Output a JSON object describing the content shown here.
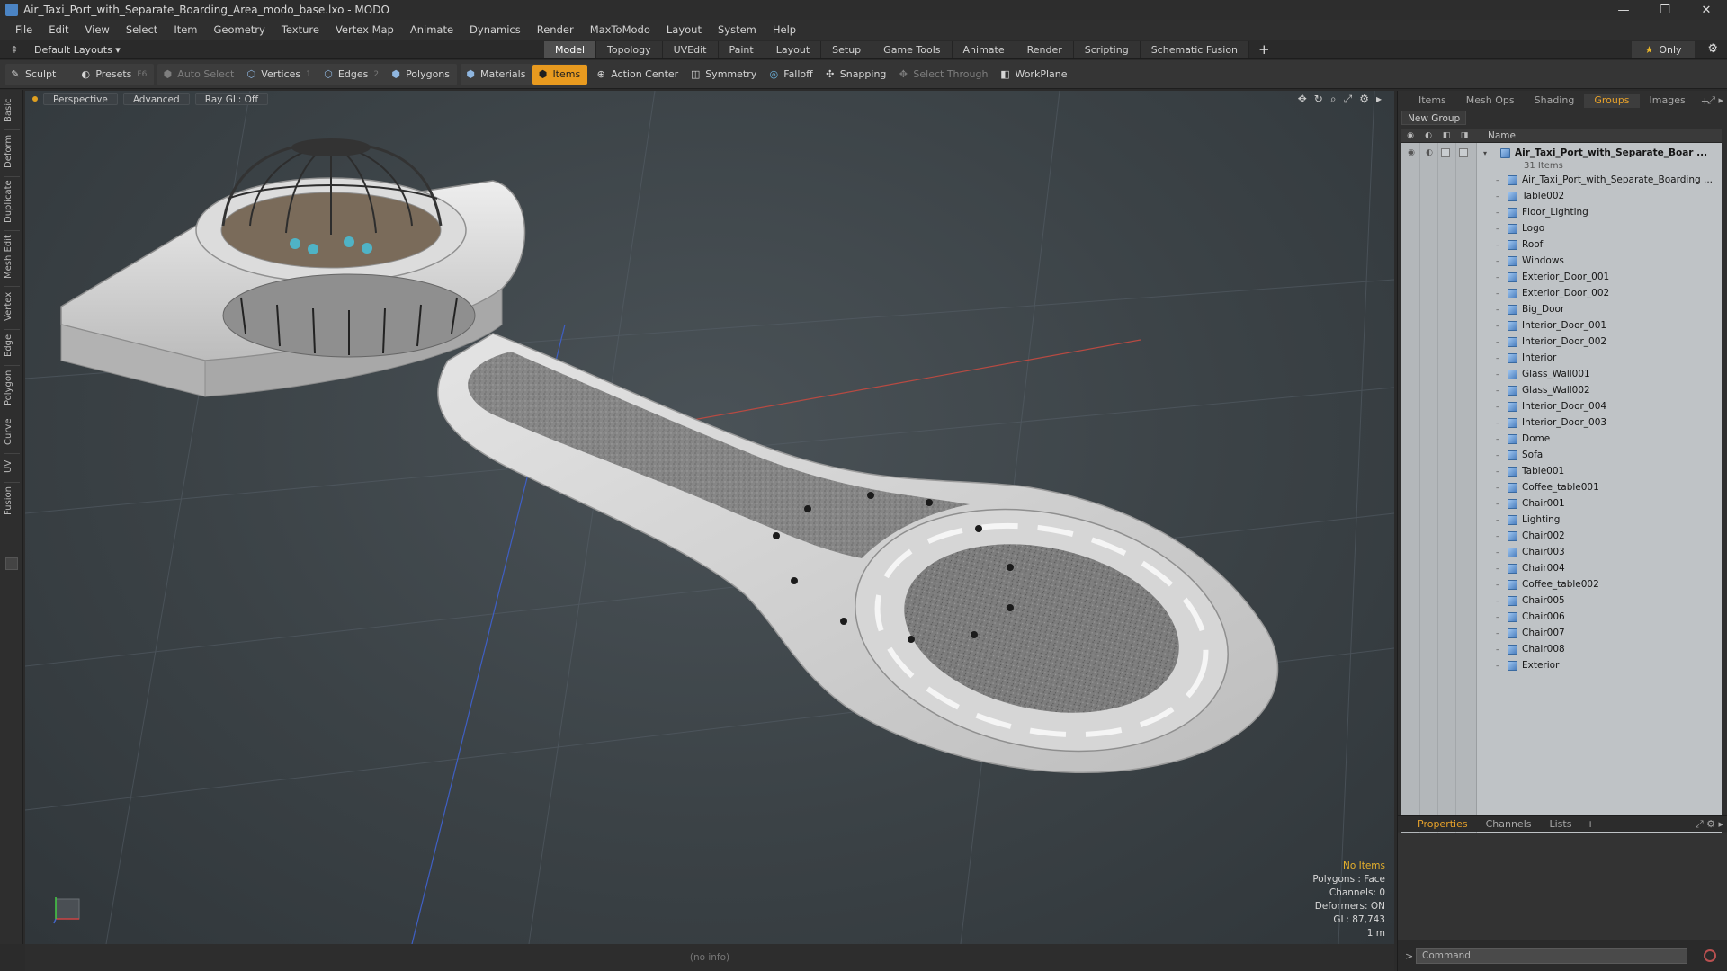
{
  "window": {
    "title": "Air_Taxi_Port_with_Separate_Boarding_Area_modo_base.lxo - MODO",
    "controls": [
      "—",
      "❐",
      "✕"
    ]
  },
  "menu": [
    "File",
    "Edit",
    "View",
    "Select",
    "Item",
    "Geometry",
    "Texture",
    "Vertex Map",
    "Animate",
    "Dynamics",
    "Render",
    "MaxToModo",
    "Layout",
    "System",
    "Help"
  ],
  "layout": {
    "selector": "Default Layouts ▾",
    "tabs": [
      "Model",
      "Topology",
      "UVEdit",
      "Paint",
      "Layout",
      "Setup",
      "Game Tools",
      "Animate",
      "Render",
      "Scripting",
      "Schematic Fusion"
    ],
    "active_tab": "Model",
    "add_tab": "+",
    "only_label": "Only"
  },
  "toolbar": {
    "sculpt": "Sculpt",
    "presets": "Presets",
    "presets_hint": "F6",
    "auto_select": "Auto Select",
    "vertices": "Vertices",
    "vertices_hint": "1",
    "edges": "Edges",
    "edges_hint": "2",
    "polygons": "Polygons",
    "materials": "Materials",
    "items": "Items",
    "action_center": "Action Center",
    "symmetry": "Symmetry",
    "falloff": "Falloff",
    "snapping": "Snapping",
    "select_through": "Select Through",
    "workplane": "WorkPlane"
  },
  "left_tabs": [
    "Basic",
    "Deform",
    "Duplicate",
    "Mesh Edit",
    "Vertex",
    "Edge",
    "Polygon",
    "Curve",
    "UV",
    "Fusion"
  ],
  "viewport": {
    "view_mode": "Perspective",
    "shading": "Advanced",
    "raygl": "Ray GL: Off",
    "stats": {
      "items": "No Items",
      "polygons": "Polygons : Face",
      "channels": "Channels: 0",
      "deformers": "Deformers: ON",
      "gl": "GL: 87,743",
      "unit": "1 m"
    },
    "status": "(no info)"
  },
  "right_panel": {
    "tabs": [
      "Items",
      "Mesh Ops",
      "Shading",
      "Groups",
      "Images"
    ],
    "active_tab": "Groups",
    "new_group": "New Group",
    "column_name": "Name",
    "root": {
      "name": "Air_Taxi_Port_with_Separate_Boar ...",
      "count": "31 Items"
    },
    "items": [
      "Air_Taxi_Port_with_Separate_Boarding ...",
      "Table002",
      "Floor_Lighting",
      "Logo",
      "Roof",
      "Windows",
      "Exterior_Door_001",
      "Exterior_Door_002",
      "Big_Door",
      "Interior_Door_001",
      "Interior_Door_002",
      "Interior",
      "Glass_Wall001",
      "Glass_Wall002",
      "Interior_Door_004",
      "Interior_Door_003",
      "Dome",
      "Sofa",
      "Table001",
      "Coffee_table001",
      "Chair001",
      "Lighting",
      "Chair002",
      "Chair003",
      "Chair004",
      "Coffee_table002",
      "Chair005",
      "Chair006",
      "Chair007",
      "Chair008",
      "Exterior"
    ],
    "bottom_tabs": [
      "Properties",
      "Channels",
      "Lists"
    ],
    "bottom_active": "Properties",
    "command_placeholder": "Command",
    "command_prompt": ">"
  },
  "colors": {
    "accent": "#e89a1f",
    "viewport_bg": "#3b4246",
    "tree_bg": "#bfc3c6"
  }
}
